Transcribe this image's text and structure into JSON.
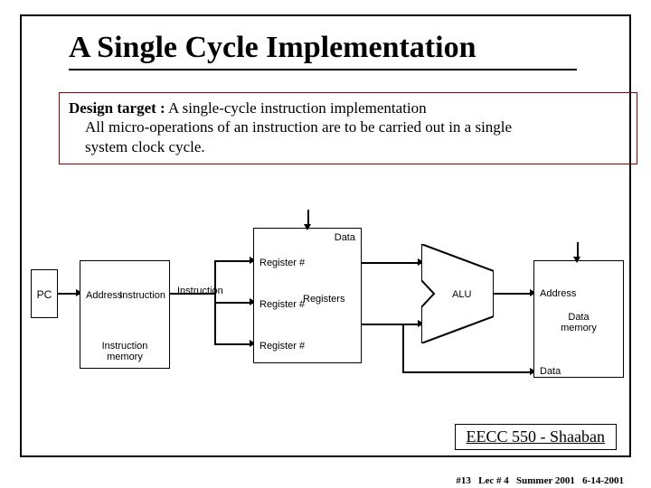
{
  "title": "A Single Cycle Implementation",
  "design": {
    "label": "Design target :",
    "line1_rest": "  A single-cycle instruction implementation",
    "line2": "All micro-operations of an instruction are to be carried out in a single",
    "line3": "system clock cycle."
  },
  "diagram": {
    "pc": "PC",
    "imem": {
      "address": "Address",
      "instruction": "Instruction",
      "caption": "Instruction\nmemory"
    },
    "regs": {
      "data": "Data",
      "reg1": "Register #",
      "reg2": "Register #",
      "reg3": "Register #",
      "caption": "Registers"
    },
    "alu": "ALU",
    "dmem": {
      "address": "Address",
      "data": "Data",
      "caption": "Data\nmemory"
    }
  },
  "footer": {
    "course": "EECC 550 - Shaaban"
  },
  "subfooter": {
    "num": "#13",
    "lec": "Lec # 4",
    "term": "Summer 2001",
    "date": "6-14-2001"
  }
}
